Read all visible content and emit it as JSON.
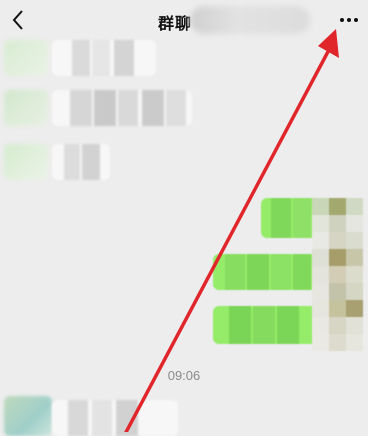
{
  "header": {
    "title": "群聊",
    "back_icon": "chevron-left-icon",
    "more_icon": "more-icon"
  },
  "messages": {
    "time_label": "09:06"
  },
  "colors": {
    "background": "#ededed",
    "bubble_outgoing": "#95ec69",
    "bubble_incoming": "#ffffff",
    "annotation_arrow": "#e0262b"
  }
}
